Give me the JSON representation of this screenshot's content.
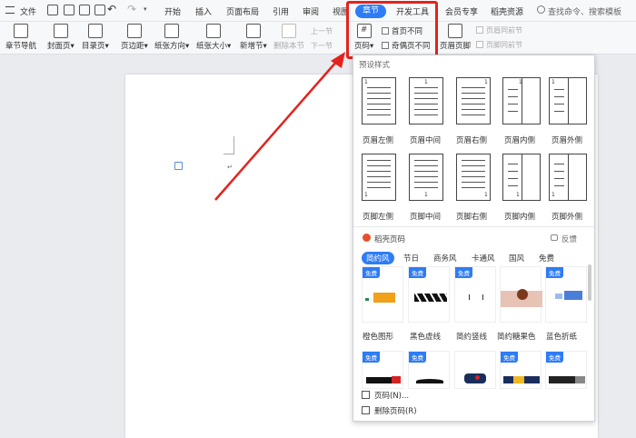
{
  "menu": {
    "file": "文件",
    "tabs": [
      "开始",
      "插入",
      "页面布局",
      "引用",
      "审阅",
      "视图",
      "章节",
      "开发工具",
      "会员专享",
      "稻壳资源"
    ],
    "active_tab": "章节",
    "search": "查找命令、搜索模板"
  },
  "ribbon": {
    "chapter_nav": "章节导航",
    "cover": "封面页",
    "toc": "目录页",
    "margins": "页边距",
    "orientation": "纸张方向",
    "size": "纸张大小",
    "new_section": "新增节",
    "delete_section": "删除本节",
    "prev_section": "上一节",
    "next_section": "下一节",
    "page_num": "页码",
    "first_diff": "首页不同",
    "odd_even_diff": "奇偶页不同",
    "header_footer": "页眉页脚",
    "same_prev_header": "页眉同前节",
    "same_prev_footer": "页脚同前节"
  },
  "panel": {
    "preset_title": "预设样式",
    "header_labels": [
      "页眉左侧",
      "页眉中间",
      "页眉右侧",
      "页眉内侧",
      "页眉外侧"
    ],
    "footer_labels": [
      "页脚左侧",
      "页脚中间",
      "页脚右侧",
      "页脚内侧",
      "页脚外侧"
    ],
    "thumb_num": "1",
    "docer_title": "稻壳页码",
    "feedback": "反馈",
    "style_tabs": [
      "简约风",
      "节日",
      "商务风",
      "卡通风",
      "国风",
      "免费"
    ],
    "free_badge": "免费",
    "cards": [
      "橙色图形",
      "黑色虚线",
      "简约竖线",
      "简约糖果色",
      "蓝色折纸"
    ],
    "page_num_item": "页码(N)...",
    "remove_item": "删除页码(R)"
  }
}
